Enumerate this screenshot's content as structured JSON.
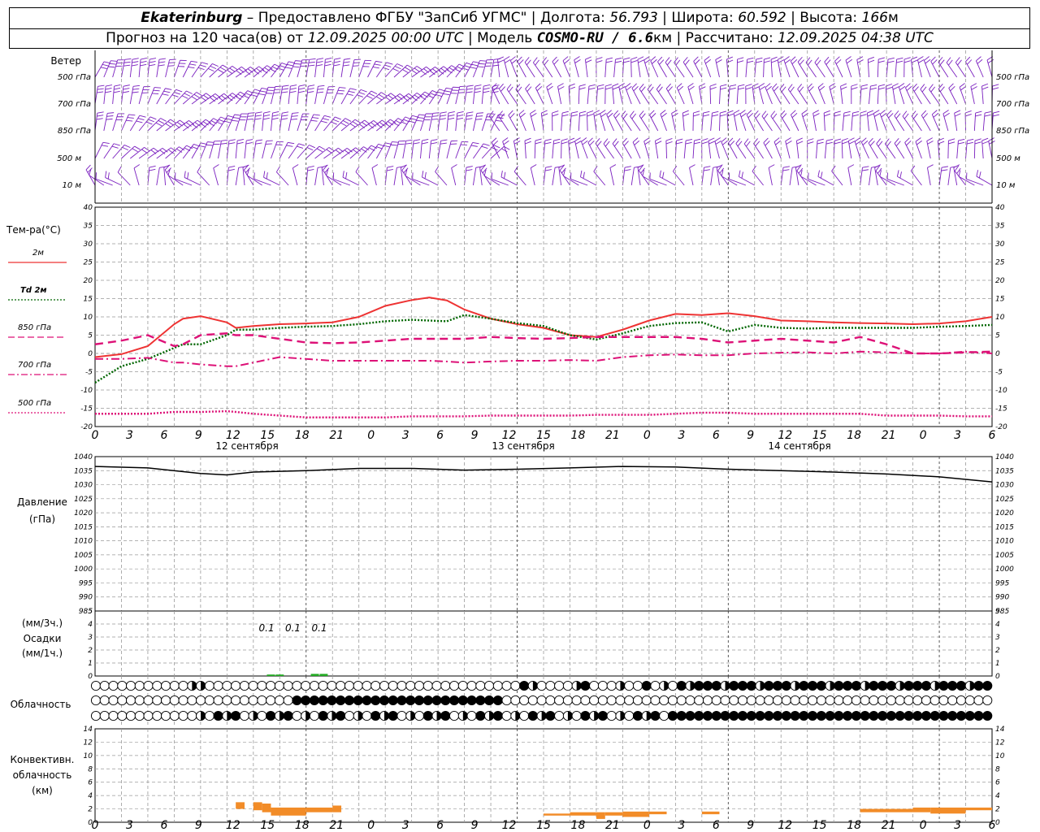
{
  "header": {
    "station": "Ekaterinburg",
    "dash": " – ",
    "provider": "Предоставлено ФГБУ \"ЗапСиб УГМС\"",
    "sep": " | ",
    "lon_label": "Долгота: ",
    "lon": "56.793",
    "lat_label": "Широта: ",
    "lat": "60.592",
    "alt_label": "Высота: ",
    "alt": "166",
    "alt_unit": "м",
    "forecast_label": "Прогноз на 120 часа(ов) от ",
    "forecast_time": "12.09.2025 00:00 UTC",
    "model_label": "Модель ",
    "model": "COSMO-RU / 6.6",
    "model_unit": "км",
    "calc_label": "Рассчитано: ",
    "calc_time": "12.09.2025 04:38 UTC"
  },
  "wind_panel": {
    "title": "Ветер",
    "levels": [
      "500 гПа",
      "700 гПа",
      "850 гПа",
      "500 м",
      "10 м"
    ]
  },
  "temp_panel": {
    "title": "Тем-ра(°C)",
    "legend": [
      {
        "label": "2м",
        "color": "#ee3333",
        "style": "solid"
      },
      {
        "label": "Td 2м",
        "color": "#006600",
        "style": "dotted"
      },
      {
        "label": "850 гПа",
        "color": "#dd1177",
        "style": "dashed"
      },
      {
        "label": "700 гПа",
        "color": "#dd1177",
        "style": "dashdot"
      },
      {
        "label": "500 гПа",
        "color": "#dd1177",
        "style": "dotted"
      }
    ]
  },
  "pressure_panel": {
    "title": "Давление",
    "unit": "(гПа)"
  },
  "precip_panel": {
    "unit_top": "(мм/3ч.)",
    "title": "Осадки",
    "unit_bottom": "(мм/1ч.)"
  },
  "cloud_panel": {
    "title": "Облачность"
  },
  "conv_panel": {
    "title_line1": "Конвективн.",
    "title_line2": "облачность",
    "unit": "(км)"
  },
  "x_ticks": [
    "0",
    "3",
    "6",
    "9",
    "12",
    "15",
    "18",
    "21",
    "0",
    "3",
    "6",
    "9",
    "12",
    "15",
    "18",
    "21",
    "0",
    "3",
    "6",
    "9",
    "12",
    "15",
    "18",
    "21",
    "0",
    "3",
    "6"
  ],
  "days": [
    "12 сентября",
    "13 сентября",
    "14 сентября"
  ],
  "chart_data": [
    {
      "type": "line",
      "title": "Тем-ра(°C)",
      "x_hours": [
        0,
        3,
        6,
        9,
        10,
        12,
        15,
        16,
        18,
        21,
        24,
        27,
        30,
        33,
        36,
        38,
        40,
        42,
        45,
        48,
        51,
        54,
        57,
        60,
        63,
        66,
        69,
        72,
        75,
        78,
        81,
        84,
        87,
        90,
        93,
        96,
        99,
        102
      ],
      "ylim": [
        -20,
        40
      ],
      "series": [
        {
          "name": "2м",
          "values": [
            -1,
            -0.2,
            2,
            8,
            9.5,
            10.2,
            8.5,
            7,
            7.5,
            8,
            8.2,
            8.5,
            10,
            13,
            14.6,
            15.3,
            14.5,
            12,
            9.5,
            8,
            7,
            5,
            4.5,
            6.5,
            9,
            10.8,
            10.5,
            11,
            10.2,
            9,
            8.8,
            8.5,
            8.3,
            8.2,
            8,
            8.2,
            8.8,
            10
          ]
        },
        {
          "name": "Td 2м",
          "values": [
            -8,
            -3.5,
            -1.5,
            1.5,
            2.5,
            2.5,
            5,
            6.5,
            6.5,
            7,
            7.3,
            7.5,
            8,
            8.8,
            9.2,
            9,
            8.8,
            10.5,
            9.5,
            8.3,
            7.5,
            5,
            3.8,
            5.5,
            7.5,
            8.3,
            8.5,
            6,
            7.8,
            7,
            6.8,
            7,
            7,
            7,
            7,
            7.3,
            7.5,
            7.8
          ]
        },
        {
          "name": "850 гПа",
          "values": [
            2.5,
            3.5,
            5,
            2,
            2.5,
            5,
            5.5,
            5,
            5,
            4,
            3,
            2.8,
            3,
            3.5,
            4,
            4,
            4,
            4,
            4.5,
            4.2,
            4,
            4.2,
            4.5,
            4.5,
            4.5,
            4.5,
            4,
            3,
            3.5,
            4,
            3.5,
            3,
            4.5,
            2.5,
            0,
            0,
            0.3,
            0.5
          ]
        },
        {
          "name": "700 гПа",
          "values": [
            -1.5,
            -1.5,
            -1.2,
            -2.5,
            -2.5,
            -3,
            -3.5,
            -3.5,
            -2.5,
            -1,
            -1.5,
            -2,
            -2,
            -2,
            -2,
            -2,
            -2.2,
            -2.5,
            -2.2,
            -2,
            -2,
            -1.8,
            -2,
            -1,
            -0.5,
            -0.3,
            -0.5,
            -0.5,
            0,
            0.2,
            0.3,
            0,
            0.5,
            0.3,
            0,
            0,
            0.5,
            0
          ]
        },
        {
          "name": "500 гПа",
          "values": [
            -16.5,
            -16.5,
            -16.5,
            -16,
            -16,
            -16,
            -15.8,
            -16,
            -16.5,
            -17,
            -17.5,
            -17.5,
            -17.5,
            -17.5,
            -17.2,
            -17.2,
            -17.2,
            -17.2,
            -17,
            -17,
            -17,
            -17,
            -16.8,
            -16.8,
            -16.8,
            -16.5,
            -16.2,
            -16.2,
            -16.5,
            -16.5,
            -16.5,
            -16.5,
            -16.5,
            -17,
            -17,
            -17,
            -17.2,
            -17.2
          ]
        }
      ]
    },
    {
      "type": "line",
      "title": "Давление",
      "x_hours": [
        0,
        6,
        12,
        15,
        18,
        24,
        30,
        36,
        42,
        48,
        54,
        60,
        66,
        72,
        78,
        84,
        90,
        96,
        102
      ],
      "ylim": [
        985,
        1040
      ],
      "series": [
        {
          "name": "",
          "values": [
            1036.5,
            1036,
            1034,
            1033.5,
            1034.5,
            1035,
            1035.8,
            1035.8,
            1035.2,
            1035.5,
            1036,
            1036.5,
            1036.3,
            1035.5,
            1035,
            1034.5,
            1033.8,
            1032.8,
            1031
          ]
        }
      ]
    },
    {
      "type": "bar",
      "title": "Осадки",
      "ylim": [
        0,
        5
      ],
      "labels": [
        "0.1",
        "0.1",
        "0.1"
      ],
      "label_hours": [
        19.5,
        22.5,
        25.5
      ],
      "x_hours": [
        20,
        21,
        25,
        26
      ],
      "values": [
        0.05,
        0.05,
        0.1,
        0.1
      ]
    },
    {
      "type": "bar",
      "title": "Конвективн. облачность",
      "ylim": [
        0,
        14
      ],
      "segments": [
        {
          "start": 16,
          "end": 17,
          "bottom": 2,
          "top": 3
        },
        {
          "start": 18,
          "end": 19,
          "bottom": 1.8,
          "top": 3
        },
        {
          "start": 19,
          "end": 20,
          "bottom": 1.5,
          "top": 2.8
        },
        {
          "start": 20,
          "end": 24,
          "bottom": 1,
          "top": 2.2
        },
        {
          "start": 24,
          "end": 27,
          "bottom": 1.5,
          "top": 2.2
        },
        {
          "start": 27,
          "end": 28,
          "bottom": 1.5,
          "top": 2.5
        },
        {
          "start": 51,
          "end": 54,
          "bottom": 1,
          "top": 1.3
        },
        {
          "start": 54,
          "end": 57,
          "bottom": 1,
          "top": 1.5
        },
        {
          "start": 57,
          "end": 58,
          "bottom": 0.5,
          "top": 1.5
        },
        {
          "start": 58,
          "end": 60,
          "bottom": 1,
          "top": 1.5
        },
        {
          "start": 60,
          "end": 63,
          "bottom": 0.8,
          "top": 1.6
        },
        {
          "start": 63,
          "end": 65,
          "bottom": 1.2,
          "top": 1.6
        },
        {
          "start": 69,
          "end": 71,
          "bottom": 1.2,
          "top": 1.6
        },
        {
          "start": 87,
          "end": 93,
          "bottom": 1.5,
          "top": 2
        },
        {
          "start": 93,
          "end": 95,
          "bottom": 1.5,
          "top": 2.2
        },
        {
          "start": 95,
          "end": 99,
          "bottom": 1.3,
          "top": 2.2
        },
        {
          "start": 99,
          "end": 102,
          "bottom": 1.8,
          "top": 2.2
        }
      ]
    }
  ]
}
